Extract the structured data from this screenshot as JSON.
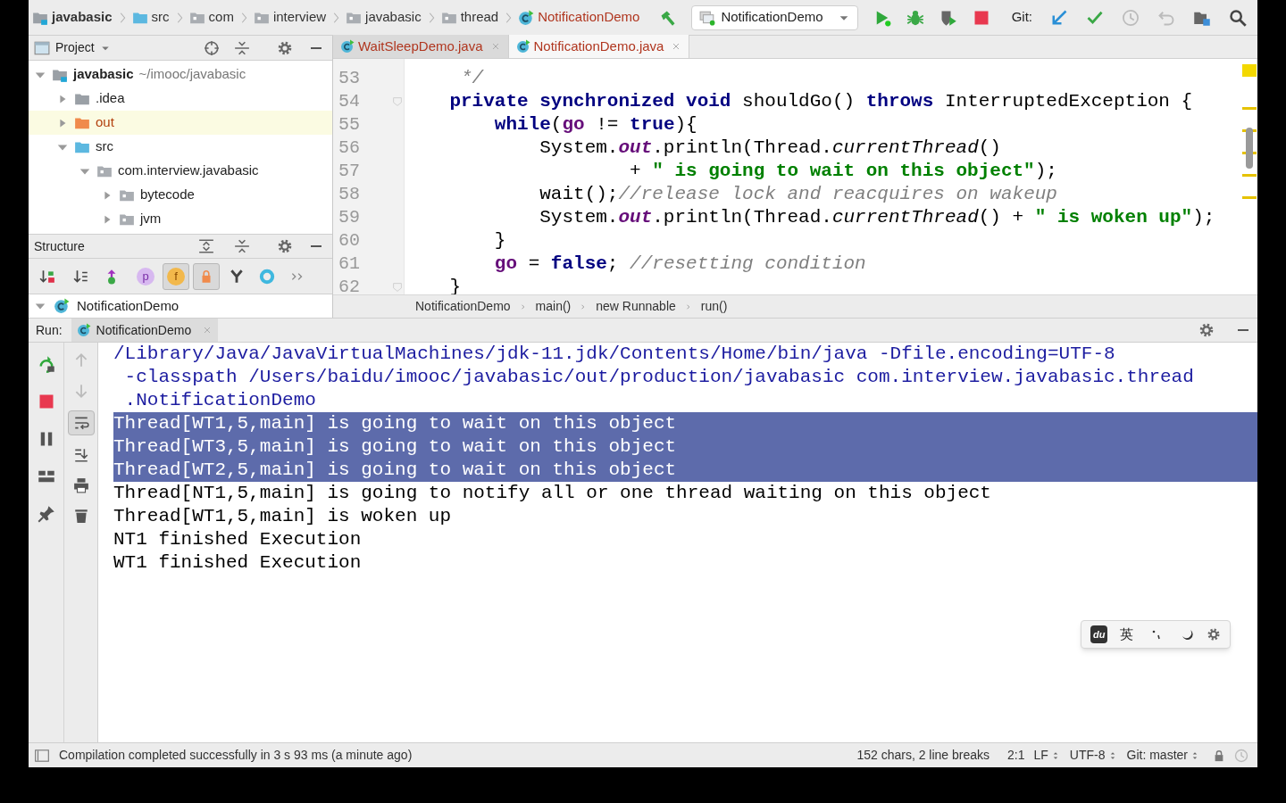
{
  "toolbar": {
    "breadcrumbs": [
      {
        "label": "javabasic",
        "kind": "project"
      },
      {
        "label": "src",
        "kind": "source"
      },
      {
        "label": "com",
        "kind": "package"
      },
      {
        "label": "interview",
        "kind": "package"
      },
      {
        "label": "javabasic",
        "kind": "package"
      },
      {
        "label": "thread",
        "kind": "package"
      },
      {
        "label": "NotificationDemo",
        "kind": "class"
      }
    ],
    "run_config": "NotificationDemo",
    "git_label": "Git:"
  },
  "project_panel": {
    "title": "Project",
    "tree": [
      {
        "label": "javabasic",
        "note": "~/imooc/javabasic",
        "kind": "project",
        "expanded": true,
        "children": [
          {
            "label": ".idea",
            "kind": "folder",
            "expanded": false
          },
          {
            "label": "out",
            "kind": "excluded",
            "expanded": false
          },
          {
            "label": "src",
            "kind": "source",
            "expanded": true,
            "children": [
              {
                "label": "com.interview.javabasic",
                "kind": "package",
                "expanded": true,
                "children": [
                  {
                    "label": "bytecode",
                    "kind": "package",
                    "expanded": false
                  },
                  {
                    "label": "jvm",
                    "kind": "package",
                    "expanded": false
                  }
                ]
              }
            ]
          }
        ]
      }
    ]
  },
  "structure_panel": {
    "title": "Structure",
    "tools": [
      {
        "kind": "sort-visibility",
        "on": false
      },
      {
        "kind": "sort-alpha",
        "on": false
      },
      {
        "kind": "inherited",
        "on": false
      },
      {
        "kind": "properties",
        "on": false,
        "label": "p"
      },
      {
        "kind": "fields",
        "on": true,
        "label": "f"
      },
      {
        "kind": "non-public",
        "on": true
      },
      {
        "kind": "lambdas",
        "on": false
      },
      {
        "kind": "anonymous",
        "on": false
      },
      {
        "kind": "more",
        "on": false
      }
    ],
    "tree": [
      {
        "label": "NotificationDemo",
        "expanded": true
      }
    ]
  },
  "editor": {
    "tabs": [
      {
        "label": "WaitSleepDemo.java",
        "selected": false
      },
      {
        "label": "NotificationDemo.java",
        "selected": true
      }
    ],
    "lines": [
      {
        "number": "53",
        "tokens": [
          {
            "text": "     */",
            "kind": "comment"
          }
        ]
      },
      {
        "number": "54",
        "tokens": [
          {
            "text": "    private synchronized void",
            "kind": "keyword"
          },
          {
            "text": " shouldGo() ",
            "kind": "plain"
          },
          {
            "text": "throws",
            "kind": "keyword"
          },
          {
            "text": " InterruptedException {",
            "kind": "plain"
          }
        ]
      },
      {
        "number": "55",
        "tokens": [
          {
            "text": "        while",
            "kind": "keyword"
          },
          {
            "text": "(",
            "kind": "plain"
          },
          {
            "text": "go",
            "kind": "field"
          },
          {
            "text": " != ",
            "kind": "plain"
          },
          {
            "text": "true",
            "kind": "keyword"
          },
          {
            "text": "){",
            "kind": "plain"
          }
        ]
      },
      {
        "number": "56",
        "tokens": [
          {
            "text": "            System.",
            "kind": "plain"
          },
          {
            "text": "out",
            "kind": "static"
          },
          {
            "text": ".println(Thread.",
            "kind": "plain"
          },
          {
            "text": "currentThread",
            "kind": "method"
          },
          {
            "text": "()",
            "kind": "plain"
          }
        ]
      },
      {
        "number": "57",
        "tokens": [
          {
            "text": "                    + ",
            "kind": "plain"
          },
          {
            "text": "\" is going to wait on this object\"",
            "kind": "string"
          },
          {
            "text": ");",
            "kind": "plain"
          }
        ]
      },
      {
        "number": "58",
        "tokens": [
          {
            "text": "            wait();",
            "kind": "plain"
          },
          {
            "text": "//release lock and reacquires on wakeup",
            "kind": "comment"
          }
        ]
      },
      {
        "number": "59",
        "tokens": [
          {
            "text": "            System.",
            "kind": "plain"
          },
          {
            "text": "out",
            "kind": "static"
          },
          {
            "text": ".println(Thread.",
            "kind": "plain"
          },
          {
            "text": "currentThread",
            "kind": "method"
          },
          {
            "text": "() + ",
            "kind": "plain"
          },
          {
            "text": "\" is woken up\"",
            "kind": "string"
          },
          {
            "text": ");",
            "kind": "plain"
          }
        ]
      },
      {
        "number": "60",
        "tokens": [
          {
            "text": "        }",
            "kind": "plain"
          }
        ]
      },
      {
        "number": "61",
        "tokens": [
          {
            "text": "        go",
            "kind": "field"
          },
          {
            "text": " = ",
            "kind": "plain"
          },
          {
            "text": "false",
            "kind": "keyword"
          },
          {
            "text": "; ",
            "kind": "plain"
          },
          {
            "text": "//resetting condition",
            "kind": "comment"
          }
        ]
      },
      {
        "number": "62",
        "tokens": [
          {
            "text": "    }",
            "kind": "plain"
          }
        ]
      }
    ],
    "breadcrumbs": [
      "NotificationDemo",
      "main()",
      "new Runnable",
      "run()"
    ]
  },
  "run_panel": {
    "label": "Run:",
    "tab": "NotificationDemo",
    "soft_wrap": true,
    "lines": [
      {
        "text": "/Library/Java/JavaVirtualMachines/jdk-11.jdk/Contents/Home/bin/java -Dfile.encoding=UTF-8",
        "kind": "command",
        "selected": false
      },
      {
        "text": " -classpath /Users/baidu/imooc/javabasic/out/production/javabasic com.interview.javabasic.thread",
        "kind": "command",
        "selected": false
      },
      {
        "text": " .NotificationDemo",
        "kind": "command",
        "selected": false
      },
      {
        "text": "Thread[WT1,5,main] is going to wait on this object",
        "kind": "output",
        "selected": true
      },
      {
        "text": "Thread[WT3,5,main] is going to wait on this object",
        "kind": "output",
        "selected": true
      },
      {
        "text": "Thread[WT2,5,main] is going to wait on this object",
        "kind": "output",
        "selected": true
      },
      {
        "text": "Thread[NT1,5,main] is going to notify all or one thread waiting on this object",
        "kind": "output",
        "selected": false
      },
      {
        "text": "Thread[WT1,5,main] is woken up",
        "kind": "output",
        "selected": false
      },
      {
        "text": "NT1 finished Execution",
        "kind": "output",
        "selected": false
      },
      {
        "text": "WT1 finished Execution",
        "kind": "output",
        "selected": false
      }
    ]
  },
  "ime_bar": {
    "logo": "du",
    "mode": "英"
  },
  "status_bar": {
    "message": "Compilation completed successfully in 3 s 93 ms (a minute ago)",
    "chars": "152 chars, 2 line breaks",
    "position": "2:1",
    "line_separator": "LF",
    "encoding": "UTF-8",
    "git": "Git: master"
  }
}
